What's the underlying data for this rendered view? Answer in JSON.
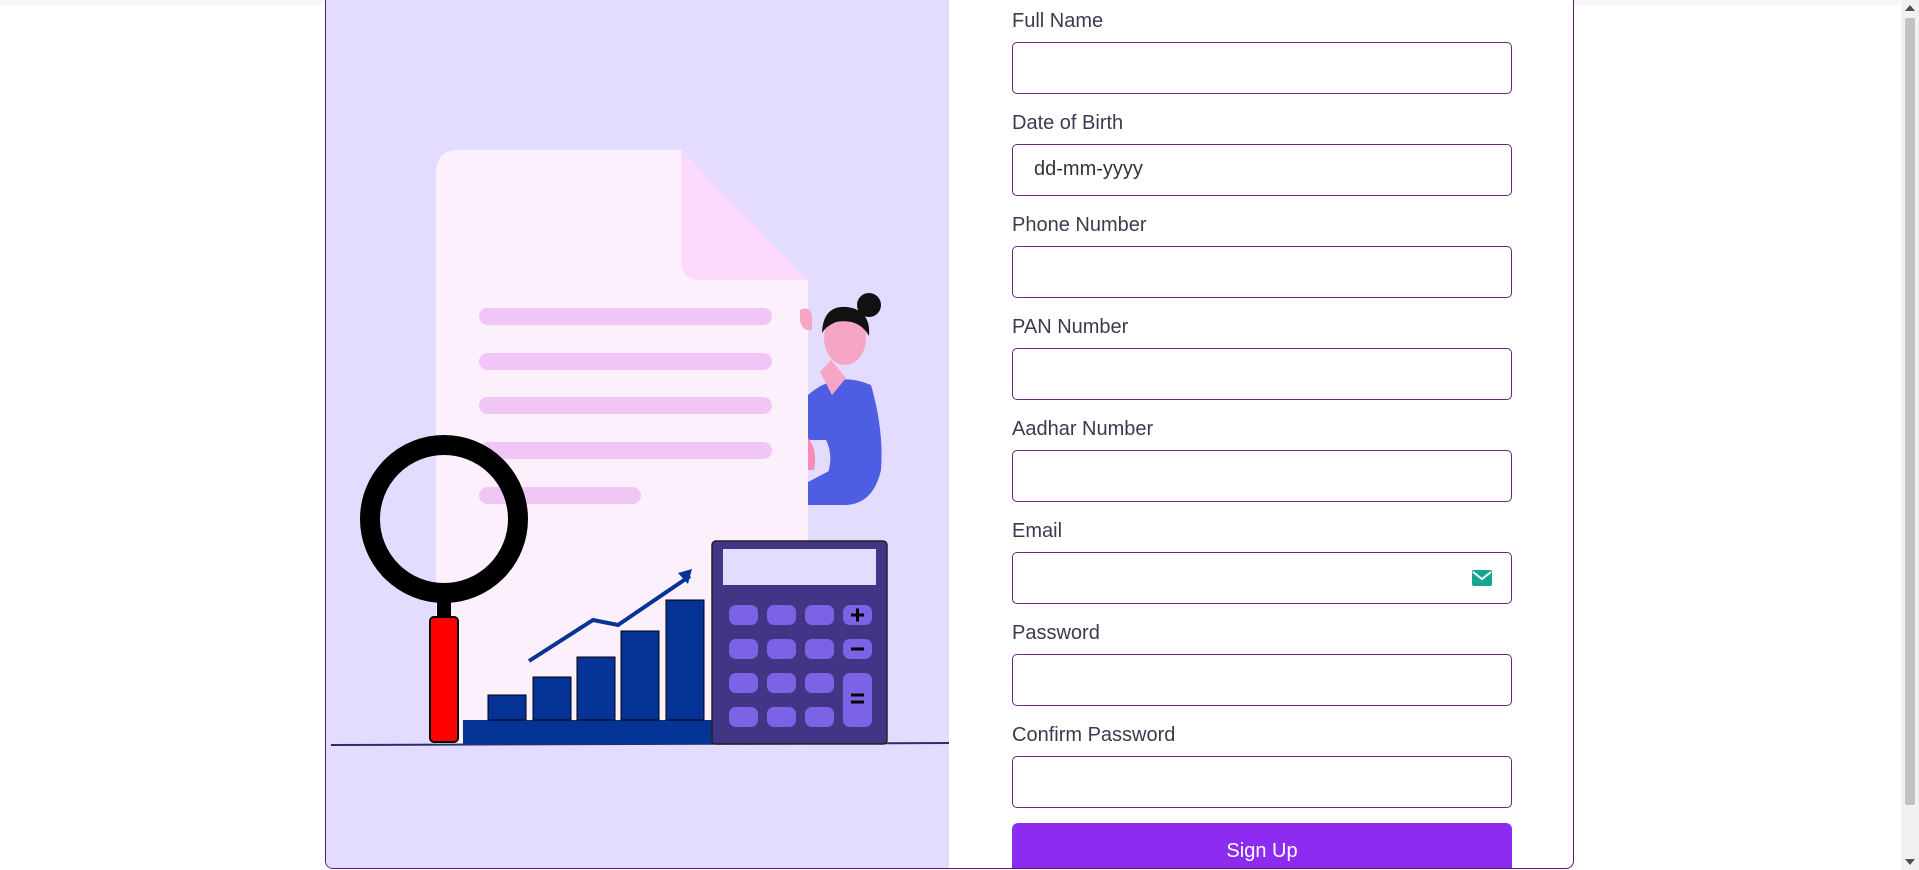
{
  "form": {
    "fields": [
      {
        "label": "Full Name",
        "value": ""
      },
      {
        "label": "Date of Birth",
        "value": "dd-mm-yyyy"
      },
      {
        "label": "Phone Number",
        "value": ""
      },
      {
        "label": "PAN Number",
        "value": ""
      },
      {
        "label": "Aadhar Number",
        "value": ""
      },
      {
        "label": "Email",
        "value": ""
      },
      {
        "label": "Password",
        "value": ""
      },
      {
        "label": "Confirm Password",
        "value": ""
      }
    ],
    "submit_label": "Sign Up"
  },
  "icons": {
    "email_field_icon": "envelope-icon"
  },
  "colors": {
    "accent": "#8d2cf0",
    "border": "#6a2585",
    "illustration_bg": "#e4dcfe"
  }
}
